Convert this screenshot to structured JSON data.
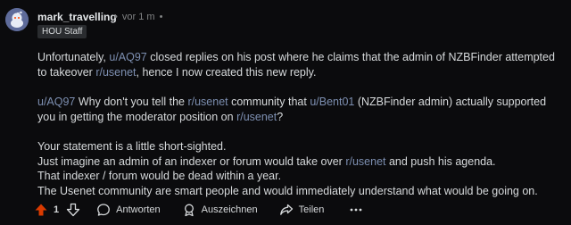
{
  "comment": {
    "username": "mark_travelling",
    "time": "vor 1 m",
    "flair": "HOU Staff",
    "avatar_icon": "snoo-avatar-icon",
    "paragraphs": [
      [
        {
          "text": "Unfortunately, ",
          "link": false
        },
        {
          "text": "u/AQ97",
          "link": true
        },
        {
          "text": " closed replies on his post where he claims that the admin of NZBFinder attempted to takeover ",
          "link": false
        },
        {
          "text": "r/usenet",
          "link": true
        },
        {
          "text": ", hence I now created this new reply.",
          "link": false
        }
      ],
      [
        {
          "text": "u/AQ97",
          "link": true
        },
        {
          "text": " Why don't you tell the ",
          "link": false
        },
        {
          "text": "r/usenet",
          "link": true
        },
        {
          "text": " community that ",
          "link": false
        },
        {
          "text": "u/Bent01",
          "link": true
        },
        {
          "text": " (NZBFinder admin) actually supported you in getting the moderator position on ",
          "link": false
        },
        {
          "text": "r/usenet",
          "link": true
        },
        {
          "text": "?",
          "link": false
        }
      ],
      [
        {
          "text": "Your statement is a little short-sighted.",
          "link": false,
          "br": true
        },
        {
          "text": "Just imagine an admin of an indexer or forum would take over ",
          "link": false
        },
        {
          "text": "r/usenet",
          "link": true
        },
        {
          "text": " and push his agenda.",
          "link": false,
          "br": true
        },
        {
          "text": "That indexer / forum would be dead within a year.",
          "link": false,
          "br": true
        },
        {
          "text": "The Usenet community are smart people and would immediately understand what would be going on.",
          "link": false
        }
      ]
    ]
  },
  "actions": {
    "vote_count": "1",
    "upvote_icon": "upvote-arrow-icon",
    "downvote_icon": "downvote-arrow-icon",
    "reply_label": "Antworten",
    "award_label": "Auszeichnen",
    "share_label": "Teilen",
    "more_icon": "more-dots-icon"
  },
  "colors": {
    "background": "#0b0b0d",
    "text": "#d7dadc",
    "muted": "#818384",
    "link": "#7d8fb1",
    "upvote": "#d93a00",
    "flair_bg": "#2a2c2f"
  }
}
